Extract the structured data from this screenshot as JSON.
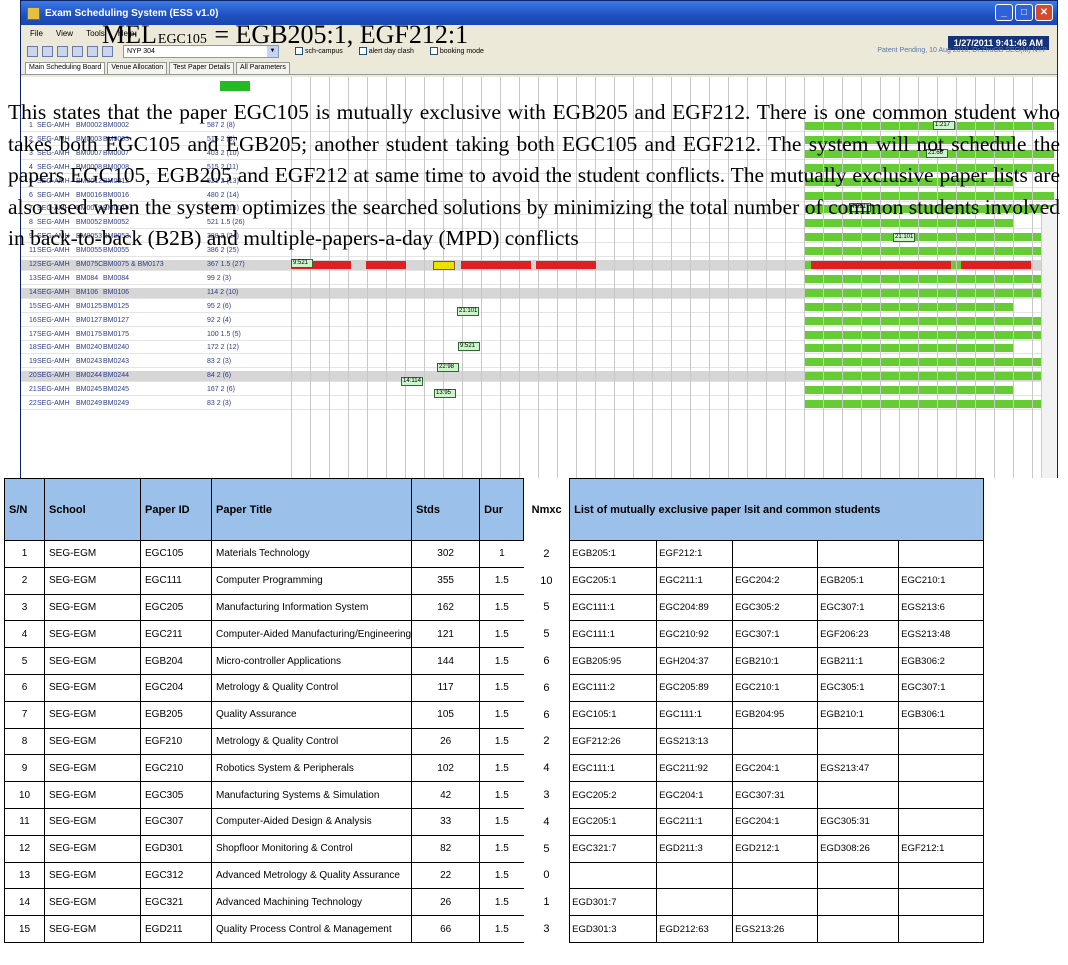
{
  "window": {
    "title": "Exam Scheduling System (ESS v1.0)",
    "clock": "1/27/2011 9:41:46 AM",
    "patent": "Patent Pending, 10 Aug 2010, Dr.ZhuGB SEG(M) NYP",
    "combo_value": "NYP 304",
    "checkboxes": [
      "sch-campus",
      "alert day clash",
      "booking mode"
    ]
  },
  "menu": [
    "File",
    "View",
    "Tools",
    "Help"
  ],
  "tabs": [
    "Main Scheduling Board",
    "Venue Allocation",
    "Test Paper Details",
    "All Parameters"
  ],
  "board": {
    "rows": [
      {
        "n": "1",
        "school": "SEG-AMH",
        "code": "BM0002",
        "code2": "BM0002",
        "stds": "587  2  (8)"
      },
      {
        "n": "2",
        "school": "SEG-AMH",
        "code": "BM0003",
        "code2": "BM0003",
        "stds": "515  2  (8)"
      },
      {
        "n": "3",
        "school": "SEG-AMH",
        "code": "BM0007",
        "code2": "BM0007",
        "stds": "403  2  (10)"
      },
      {
        "n": "4",
        "school": "SEG-AMH",
        "code": "BM0008",
        "code2": "BM0008",
        "stds": "515  2  (11)"
      },
      {
        "n": "5",
        "school": "SEG-AMH",
        "code": "BM0012",
        "code2": "BM0012",
        "stds": "521  2  (13)"
      },
      {
        "n": "6",
        "school": "SEG-AMH",
        "code": "BM0016",
        "code2": "BM0016",
        "stds": "480  2  (14)"
      },
      {
        "n": "7",
        "school": "SEG-AMH",
        "code": "BM0019",
        "code2": "BM0019",
        "stds": "519  2  (16)"
      },
      {
        "n": "8",
        "school": "SEG-AMH",
        "code": "BM0052",
        "code2": "BM0052",
        "stds": "521  1.5  (26)"
      },
      {
        "n": "9",
        "school": "SEG-AMH",
        "code": "BM0053",
        "code2": "BM0053",
        "stds": "388  2  (24)"
      },
      {
        "n": "11",
        "school": "SEG-AMH",
        "code": "BM0055",
        "code2": "BM0055",
        "stds": "386  2  (25)"
      },
      {
        "n": "12",
        "school": "SEG-AMH",
        "code": "BM075C",
        "code2": "BM0075 & BM0173",
        "stds": "367  1.5  (27)"
      },
      {
        "n": "13",
        "school": "SEG-AMH",
        "code": "BM084",
        "code2": "BM0084",
        "stds": "99  2  (3)"
      },
      {
        "n": "14",
        "school": "SEG-AMH",
        "code": "BM106",
        "code2": "BM0106",
        "stds": "114  2  (10)"
      },
      {
        "n": "15",
        "school": "SEG-AMH",
        "code": "BM0125",
        "code2": "BM0125",
        "stds": "95  2  (6)"
      },
      {
        "n": "16",
        "school": "SEG-AMH",
        "code": "BM0127",
        "code2": "BM0127",
        "stds": "92  2  (4)"
      },
      {
        "n": "17",
        "school": "SEG-AMH",
        "code": "BM0175",
        "code2": "BM0175",
        "stds": "100  1.5  (5)"
      },
      {
        "n": "18",
        "school": "SEG-AMH",
        "code": "BM0240",
        "code2": "BM0240",
        "stds": "172  2  (12)"
      },
      {
        "n": "19",
        "school": "SEG-AMH",
        "code": "BM0243",
        "code2": "BM0243",
        "stds": "83  2  (3)"
      },
      {
        "n": "20",
        "school": "SEG-AMH",
        "code": "BM0244",
        "code2": "BM0244",
        "stds": "84  2  (6)"
      },
      {
        "n": "21",
        "school": "SEG-AMH",
        "code": "BM0245",
        "code2": "BM0245",
        "stds": "167  2  (6)"
      },
      {
        "n": "22",
        "school": "SEG-AMH",
        "code": "BM0249",
        "code2": "BM0249",
        "stds": "83  2  (3)"
      }
    ],
    "cell_labels": [
      "1:217",
      "21:66",
      "4:921",
      "21:101",
      "9:521",
      "21:101",
      "9:521",
      "22:98",
      "14:114",
      "13:95",
      "17:103",
      "16:172",
      "13:83",
      "20:84",
      "21:167",
      "22:221"
    ]
  },
  "doc": {
    "heading_pre": "MEL",
    "heading_sub": "EGC105",
    "heading_post": " = EGB205:1, EGF212:1",
    "paragraph": "This states that the paper EGC105 is mutually exclusive with EGB205 and EGF212. There is one common student who takes both EGC105 and EGB205; another student taking both EGC105 and EGF212. The system will not schedule the papers EGC105, EGB205 and EGF212 at same time to avoid the student conflicts. The mutually exclusive paper lists are also used when the system optimizes the searched solutions by minimizing the total number of common students involved in back-to-back (B2B) and multiple-papers-a-day (MPD) conflicts"
  },
  "table": {
    "headers": {
      "sn": "S/N",
      "school": "School",
      "paper_id": "Paper ID",
      "title": "Paper Title",
      "stds": "Stds",
      "dur": "Dur",
      "nmxc": "Nmxc",
      "list": "List of mutually exclusive paper lsit and common students"
    },
    "rows": [
      {
        "sn": "1",
        "school": "SEG-EGM",
        "id": "EGC105",
        "title": "Materials Technology",
        "stds": "302",
        "dur": "1",
        "nmxc": "2",
        "list": [
          "EGB205:1",
          "EGF212:1",
          "",
          "",
          ""
        ]
      },
      {
        "sn": "2",
        "school": "SEG-EGM",
        "id": "EGC111",
        "title": "Computer Programming",
        "stds": "355",
        "dur": "1.5",
        "nmxc": "10",
        "list": [
          "EGC205:1",
          "EGC211:1",
          "EGC204:2",
          "EGB205:1",
          "EGC210:1"
        ]
      },
      {
        "sn": "3",
        "school": "SEG-EGM",
        "id": "EGC205",
        "title": "Manufacturing Information System",
        "stds": "162",
        "dur": "1.5",
        "nmxc": "5",
        "list": [
          "EGC111:1",
          "EGC204:89",
          "EGC305:2",
          "EGC307:1",
          "EGS213:6"
        ]
      },
      {
        "sn": "4",
        "school": "SEG-EGM",
        "id": "EGC211",
        "title": "Computer-Aided Manufacturing/Engineering",
        "stds": "121",
        "dur": "1.5",
        "nmxc": "5",
        "list": [
          "EGC111:1",
          "EGC210:92",
          "EGC307:1",
          "EGF206:23",
          "EGS213:48"
        ]
      },
      {
        "sn": "5",
        "school": "SEG-EGM",
        "id": "EGB204",
        "title": "Micro-controller Applications",
        "stds": "144",
        "dur": "1.5",
        "nmxc": "6",
        "list": [
          "EGB205:95",
          "EGH204:37",
          "EGB210:1",
          "EGB211:1",
          "EGB306:2"
        ]
      },
      {
        "sn": "6",
        "school": "SEG-EGM",
        "id": "EGC204",
        "title": "Metrology & Quality Control",
        "stds": "117",
        "dur": "1.5",
        "nmxc": "6",
        "list": [
          "EGC111:2",
          "EGC205:89",
          "EGC210:1",
          "EGC305:1",
          "EGC307:1"
        ]
      },
      {
        "sn": "7",
        "school": "SEG-EGM",
        "id": "EGB205",
        "title": "Quality Assurance",
        "stds": "105",
        "dur": "1.5",
        "nmxc": "6",
        "list": [
          "EGC105:1",
          "EGC111:1",
          "EGB204:95",
          "EGB210:1",
          "EGB306:1"
        ]
      },
      {
        "sn": "8",
        "school": "SEG-EGM",
        "id": "EGF210",
        "title": "Metrology & Quality Control",
        "stds": "26",
        "dur": "1.5",
        "nmxc": "2",
        "list": [
          "EGF212:26",
          "EGS213:13",
          "",
          "",
          ""
        ]
      },
      {
        "sn": "9",
        "school": "SEG-EGM",
        "id": "EGC210",
        "title": "Robotics System & Peripherals",
        "stds": "102",
        "dur": "1.5",
        "nmxc": "4",
        "list": [
          "EGC111:1",
          "EGC211:92",
          "EGC204:1",
          "EGS213:47",
          ""
        ]
      },
      {
        "sn": "10",
        "school": "SEG-EGM",
        "id": "EGC305",
        "title": "Manufacturing Systems & Simulation",
        "stds": "42",
        "dur": "1.5",
        "nmxc": "3",
        "list": [
          "EGC205:2",
          "EGC204:1",
          "EGC307:31",
          "",
          ""
        ]
      },
      {
        "sn": "11",
        "school": "SEG-EGM",
        "id": "EGC307",
        "title": "Computer-Aided Design & Analysis",
        "stds": "33",
        "dur": "1.5",
        "nmxc": "4",
        "list": [
          "EGC205:1",
          "EGC211:1",
          "EGC204:1",
          "EGC305:31",
          ""
        ]
      },
      {
        "sn": "12",
        "school": "SEG-EGM",
        "id": "EGD301",
        "title": "Shopfloor Monitoring & Control",
        "stds": "82",
        "dur": "1.5",
        "nmxc": "5",
        "list": [
          "EGC321:7",
          "EGD211:3",
          "EGD212:1",
          "EGD308:26",
          "EGF212:1"
        ]
      },
      {
        "sn": "13",
        "school": "SEG-EGM",
        "id": "EGC312",
        "title": "Advanced Metrology & Quality Assurance",
        "stds": "22",
        "dur": "1.5",
        "nmxc": "0",
        "list": [
          "",
          "",
          "",
          "",
          ""
        ]
      },
      {
        "sn": "14",
        "school": "SEG-EGM",
        "id": "EGC321",
        "title": "Advanced Machining Technology",
        "stds": "26",
        "dur": "1.5",
        "nmxc": "1",
        "list": [
          "EGD301:7",
          "",
          "",
          "",
          ""
        ]
      },
      {
        "sn": "15",
        "school": "SEG-EGM",
        "id": "EGD211",
        "title": "Quality Process Control & Management",
        "stds": "66",
        "dur": "1.5",
        "nmxc": "3",
        "list": [
          "EGD301:3",
          "EGD212:63",
          "EGS213:26",
          "",
          ""
        ]
      }
    ]
  }
}
